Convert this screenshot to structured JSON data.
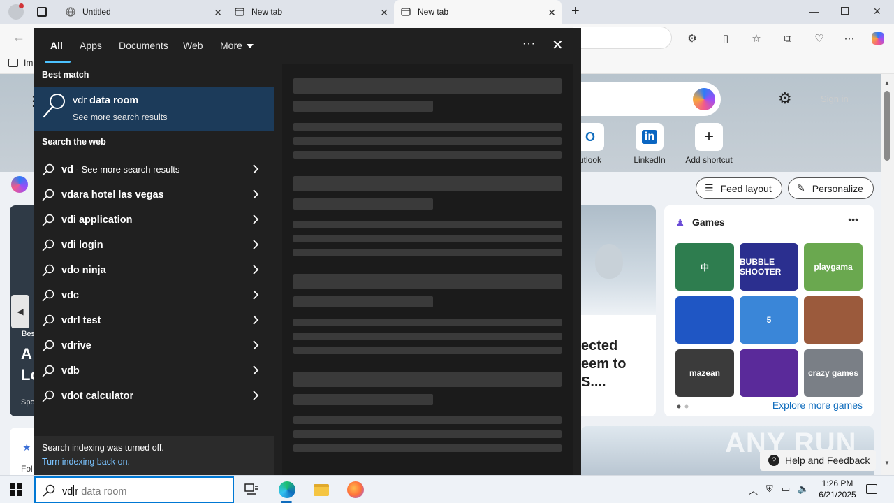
{
  "browser": {
    "tabs": [
      {
        "title": "Untitled",
        "icon": "globe-icon"
      },
      {
        "title": "New tab",
        "icon": "newtab-icon"
      },
      {
        "title": "New tab",
        "icon": "newtab-icon",
        "active": true
      }
    ],
    "favorites_bar": {
      "first_item": "Im"
    }
  },
  "newtab": {
    "sign_in": "Sign in",
    "shortcuts": [
      {
        "label": "utlook"
      },
      {
        "label": "LinkedIn"
      },
      {
        "label": "Add shortcut"
      }
    ],
    "feed_layout": "Feed layout",
    "personalize": "Personalize",
    "news_partial": [
      "ected",
      "eem to",
      "S...."
    ],
    "left_partial": {
      "tag": "Bes",
      "line1": "A",
      "line2": "Lo",
      "source": "Spo",
      "follow": "Fol"
    },
    "games": {
      "title": "Games",
      "explore": "Explore more games",
      "tiles": [
        {
          "name": "mahjong",
          "label": "中",
          "color": "#2e7d4f"
        },
        {
          "name": "bubble-shooter",
          "label": "BUBBLE SHOOTER",
          "color": "#2b2f8f"
        },
        {
          "name": "playgama-car",
          "label": "playgama",
          "color": "#6aa84f"
        },
        {
          "name": "block-puzzle",
          "label": "",
          "color": "#1f56c4"
        },
        {
          "name": "shark-5",
          "label": "5",
          "color": "#3a86d8"
        },
        {
          "name": "girl-puzzle",
          "label": "",
          "color": "#9b5a3c"
        },
        {
          "name": "mazean",
          "label": "mazean",
          "color": "#3b3b3b"
        },
        {
          "name": "water-sort",
          "label": "",
          "color": "#5a2a9a"
        },
        {
          "name": "racing",
          "label": "crazy games",
          "color": "#7a7f86"
        }
      ]
    },
    "help_feedback": "Help and Feedback",
    "watermark": "ANY RUN"
  },
  "search_panel": {
    "tabs": [
      "All",
      "Apps",
      "Documents",
      "Web",
      "More"
    ],
    "best_match_heading": "Best match",
    "best_match": {
      "prefix": "vdr",
      "rest": " data room",
      "sub": "See more search results"
    },
    "web_heading": "Search the web",
    "suggestions": [
      {
        "bold": "vd",
        "plain": " - See more search results"
      },
      {
        "bold": "vdara hotel las vegas",
        "plain": ""
      },
      {
        "bold": "vdi application",
        "plain": ""
      },
      {
        "bold": "vdi login",
        "plain": ""
      },
      {
        "bold": "vdo ninja",
        "plain": ""
      },
      {
        "bold": "vdc",
        "plain": ""
      },
      {
        "bold": "vdrl test",
        "plain": ""
      },
      {
        "bold": "vdrive",
        "plain": ""
      },
      {
        "bold": "vdb",
        "plain": ""
      },
      {
        "bold": "vdot calculator",
        "plain": ""
      }
    ],
    "footer": {
      "notice": "Search indexing was turned off.",
      "link": "Turn indexing back on."
    }
  },
  "taskbar": {
    "search_typed": "vd",
    "search_typed_after_caret": "r",
    "search_completion": " data room",
    "time": "1:26 PM",
    "date": "6/21/2025"
  },
  "colors": {
    "accent": "#4cc2ff",
    "best_match_bg": "#1c3b5a",
    "panel_bg": "#202020"
  }
}
